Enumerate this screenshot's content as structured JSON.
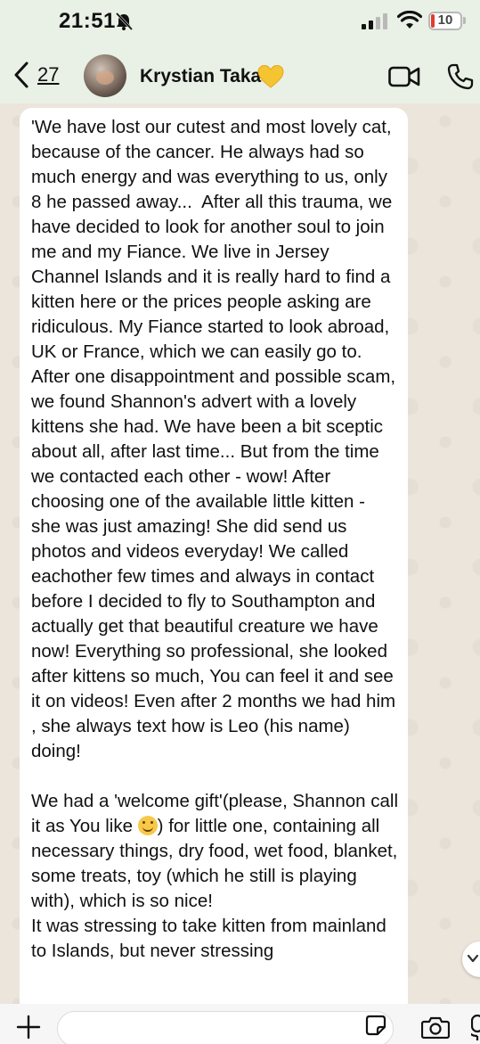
{
  "status_bar": {
    "time": "21:51",
    "battery_level": "10",
    "icons": [
      "bell-muted-icon",
      "cellular-signal-icon",
      "wifi-icon",
      "battery-icon"
    ]
  },
  "header": {
    "back_count": "27",
    "contact_name": "Krystian Taka",
    "icons": [
      "back-chevron-icon",
      "yellow-heart-icon",
      "video-call-icon",
      "phone-call-icon"
    ]
  },
  "message": {
    "part1": "'We have lost our cutest and most lovely cat, because of the cancer. He always had so much energy and was everything to us, only 8 he passed away...  After all this trauma, we have decided to look for another soul to join me and my Fiance. We live in Jersey Channel Islands and it is really hard to find a kitten here or the prices people asking are ridiculous. My Fiance started to look abroad, UK or France, which we can easily go to. After one disappointment and possible scam, we found Shannon's advert with a lovely kittens she had. We have been a bit sceptic about all, after last time... But from the time we contacted each other - wow! After choosing one of the available little kitten - she was just amazing! She did send us photos and videos everyday! We called eachother few times and always in contact before I decided to fly to Southampton and actually get that beautiful creature we have now! Everything so professional, she looked after kittens so much, You can feel it and see it on videos! Even after 2 months we had him , she always text how is Leo (his name) doing!\n\nWe had a 'welcome gift'(please, Shannon call it as You like ",
    "part2": ") for little one, containing all necessary things, dry food, wet food, blanket, some treats, toy (which he still is playing with), which is so nice!\nIt was stressing to take kitten from mainland to Islands, but never stressing"
  },
  "input_bar": {
    "icons": [
      "plus-icon",
      "sticker-icon",
      "camera-icon",
      "microphone-icon"
    ]
  },
  "colors": {
    "header_bg": "#e9f0e6",
    "chat_bg": "#ece5dc",
    "bubble_bg": "#ffffff",
    "battery_low": "#e23b30",
    "heart": "#f5c431"
  }
}
